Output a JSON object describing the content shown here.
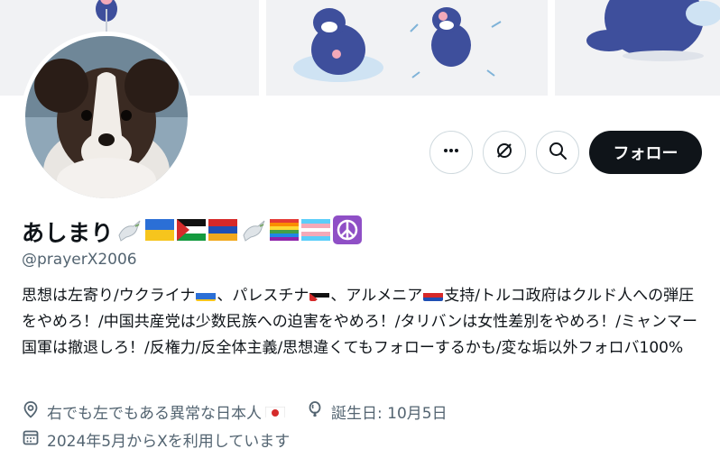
{
  "profile": {
    "display_name": "あしまり",
    "handle": "@prayerX2006",
    "name_emojis": [
      "dove-icon",
      "ukraine-flag",
      "palestine-flag",
      "armenia-flag",
      "dove-icon",
      "rainbow-flag",
      "transgender-flag",
      "peace-symbol-icon"
    ],
    "bio": {
      "part1": "思想は左寄り/ウクライナ",
      "part2": "、パレスチナ",
      "part3": "、アルメニア",
      "part4": "支持/トルコ政府はクルド人への弾圧をやめろ！/中国共産党は少数民族への迫害をやめろ！/タリバンは女性差別をやめろ！/ミャンマー国軍は撤退しろ！/反権力/反全体主義/思想違くてもフォローするかも/変な垢以外フォロバ100%"
    },
    "location": "右でも左でもある異常な日本人",
    "birthday": "誕生日: 10月5日",
    "joined": "2024年5月からXを利用しています"
  },
  "actions": {
    "follow_label": "フォロー"
  },
  "colors": {
    "primary_text": "#0f1419",
    "secondary_text": "#536471",
    "button_border": "#cfd9de",
    "follow_bg": "#0f1419",
    "banner_bg": "#f1f2f4"
  }
}
